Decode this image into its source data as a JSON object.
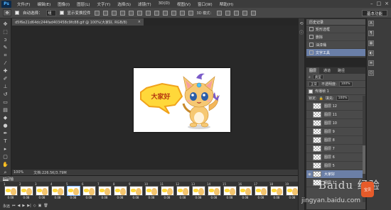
{
  "app": {
    "logo": "Ps",
    "menu": [
      "文件(F)",
      "编辑(E)",
      "图像(I)",
      "图层(L)",
      "文字(Y)",
      "选择(S)",
      "滤镜(T)",
      "3D(D)",
      "视图(V)",
      "窗口(W)",
      "帮助(H)"
    ],
    "window_controls": [
      "–",
      "□",
      "×"
    ]
  },
  "options": {
    "auto_select_label": "自动选择：",
    "auto_select_value": "组",
    "show_transform_label": "显示变换控件",
    "mode_3d_label": "3D 模式：",
    "workspace": "基本功能"
  },
  "document": {
    "tab_title": "d5f6e21d64dc244fad403458c9fc88.gif @ 100%(大家好, RGB/8)",
    "close": "×",
    "speech_text": "大家好"
  },
  "status": {
    "zoom": "100%",
    "doc_size": "文档:226.5K/3.79M"
  },
  "timeline": {
    "title": "时间轴",
    "frames": [
      {
        "n": "1",
        "d": "0.08"
      },
      {
        "n": "2",
        "d": "0.08"
      },
      {
        "n": "3",
        "d": "0.08"
      },
      {
        "n": "4",
        "d": "0.08"
      },
      {
        "n": "5",
        "d": "0.08"
      },
      {
        "n": "6",
        "d": "0.08"
      },
      {
        "n": "7",
        "d": "0.08"
      },
      {
        "n": "8",
        "d": "0.08"
      },
      {
        "n": "9",
        "d": "0.08"
      },
      {
        "n": "10",
        "d": "0.08"
      },
      {
        "n": "11",
        "d": "0.08"
      },
      {
        "n": "12",
        "d": "0.08"
      },
      {
        "n": "13",
        "d": "0.08"
      },
      {
        "n": "14",
        "d": "0.08"
      },
      {
        "n": "15",
        "d": "0.08"
      },
      {
        "n": "16",
        "d": "0.08"
      },
      {
        "n": "17",
        "d": "0.08"
      },
      {
        "n": "18",
        "d": "0.08"
      },
      {
        "n": "19",
        "d": "0.08"
      }
    ],
    "selected_frame": 4,
    "loop": "永远"
  },
  "history": {
    "title": "历史记录",
    "rows": [
      "矩形选框",
      "删除",
      "油漆桶",
      "文字工具"
    ],
    "active_index": 3
  },
  "panel_icons": [
    {
      "glyph": "A",
      "label": ""
    },
    {
      "glyph": "¶",
      "label": ""
    },
    {
      "glyph": "▦",
      "label": ""
    },
    {
      "glyph": "◐",
      "label": ""
    },
    {
      "glyph": "≣",
      "label": ""
    },
    {
      "glyph": "⬡",
      "label": ""
    }
  ],
  "layers": {
    "tabs": [
      "图层",
      "通道",
      "路径"
    ],
    "kind_label": "类型",
    "blend_mode": "正常",
    "opacity_label": "不透明度:",
    "opacity_value": "100%",
    "propagate_label": "传播帧 1",
    "lock_label": "锁定:",
    "fill_label": "填充:",
    "fill_value": "100%",
    "items": [
      "图层 12",
      "图层 11",
      "图层 10",
      "图层 9",
      "图层 8",
      "图层 7",
      "图层 6",
      "图层 5",
      "大家好",
      "图层 1"
    ],
    "selected_index": 8
  },
  "watermark": {
    "brand": "Baidu 经验",
    "url": "jingyan.baidu.com",
    "badge": "宝贝"
  },
  "colors": {
    "bubble_fill": "#ffd83a",
    "bubble_stroke": "#f0a21b",
    "speech_text": "#b5360f",
    "selection": "#6b7fa6"
  }
}
